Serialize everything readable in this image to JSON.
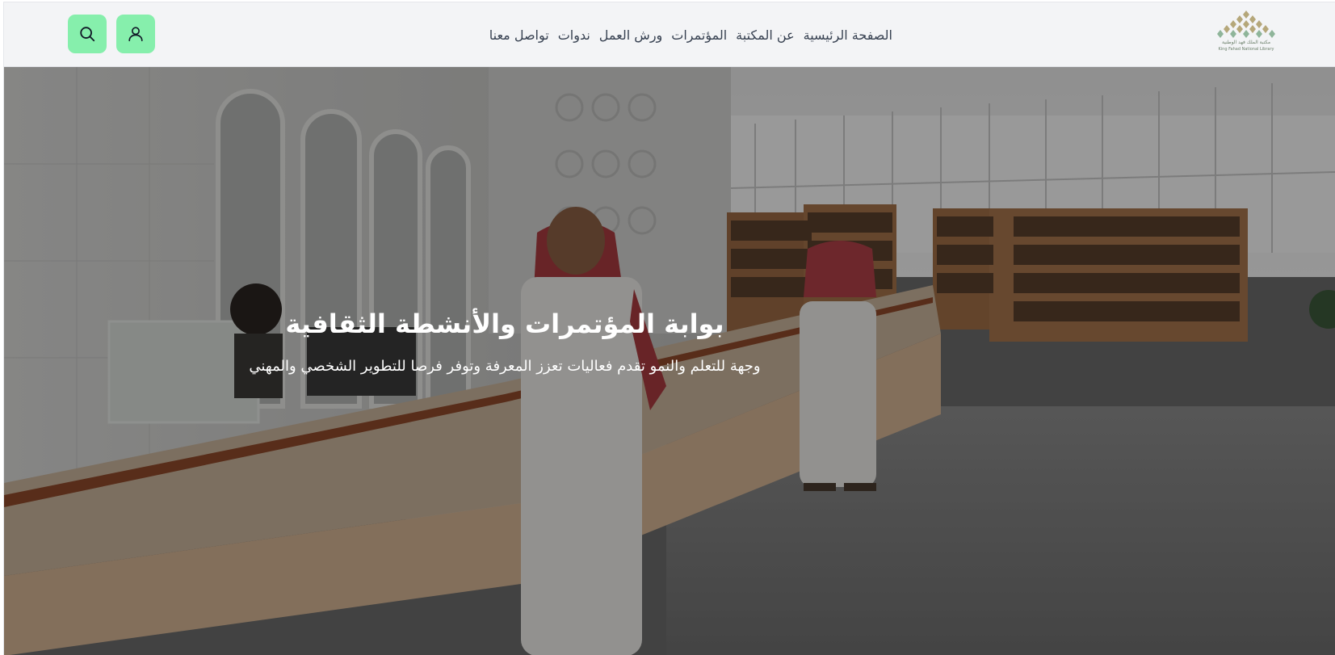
{
  "header": {
    "logo": {
      "name_ar": "مكتبة الملك فهد الوطنية",
      "name_en": "King Fahad National Library",
      "color": "#a89f7a"
    },
    "nav_links": [
      {
        "label": "الصفحة الرئيسية"
      },
      {
        "label": "عن المكتبة"
      },
      {
        "label": "المؤتمرات"
      },
      {
        "label": "ورش العمل"
      },
      {
        "label": "ندوات"
      },
      {
        "label": "تواصل معنا"
      }
    ],
    "actions": [
      {
        "icon": "user-icon"
      },
      {
        "icon": "search-icon"
      }
    ],
    "accent_color": "#86efac"
  },
  "hero": {
    "title": "بوابة المؤتمرات والأنشطة الثقافية",
    "subtitle": "وجهة للتعلم والنمو تقدم فعاليات تعزز المعرفة وتوفر فرصا للتطوير الشخصي والمهني",
    "image_subject": "library-reception-desk-photo"
  }
}
